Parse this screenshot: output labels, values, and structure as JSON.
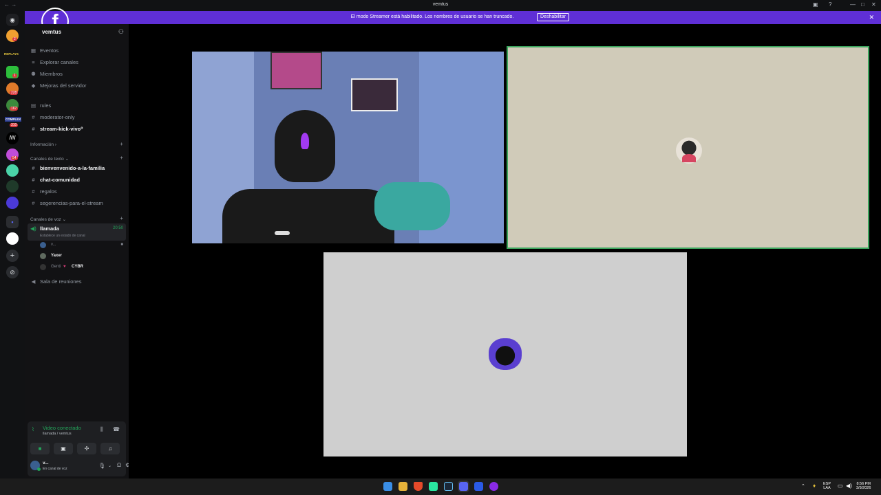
{
  "window": {
    "title": "vemtus"
  },
  "banner": {
    "text": "El modo Streamer está habilitado. Los nombres de usuario se han truncado.",
    "button": "Deshabilitar"
  },
  "rail": {
    "badges": [
      "2",
      "1",
      "228",
      "167",
      "310",
      "54"
    ],
    "label_replays": "REPLAYS",
    "label_complex": "COMPLEX"
  },
  "server": {
    "name": "vemtus"
  },
  "nav": {
    "eventos": "Eventos",
    "explorar": "Explorar canales",
    "miembros": "Miembros",
    "mejoras": "Mejoras del servidor"
  },
  "channels_top": [
    "rules",
    "moderator-only",
    "stream-kick-vivo⁰"
  ],
  "categories": {
    "informacion": "Información",
    "texto": "Canales de texto",
    "voz": "Canales de voz"
  },
  "text_channels": [
    "bienvenvenido-a-la-familia",
    "chat-comunidad",
    "regalos",
    "segerencias-para-el-stream"
  ],
  "voice": {
    "llamada": "llamada",
    "timer": "20:50",
    "status_hint": "Establece un estado de canal",
    "users": [
      "v...",
      "Yaxer",
      "Genti",
      "CYBR"
    ],
    "sala": "Sala de reuniones"
  },
  "panel": {
    "status": "Video conectado",
    "location": "llamada / vemtus",
    "user": "v...",
    "user_status": "En canal de voz"
  },
  "taskbar": {
    "lang1": "ESP",
    "lang2": "LAA",
    "time": "8:56 PM",
    "date": "3/9/2026"
  },
  "colors": {
    "banner": "#5f2fd6",
    "speaking_border": "#3ba55d",
    "connected": "#23a55a"
  }
}
